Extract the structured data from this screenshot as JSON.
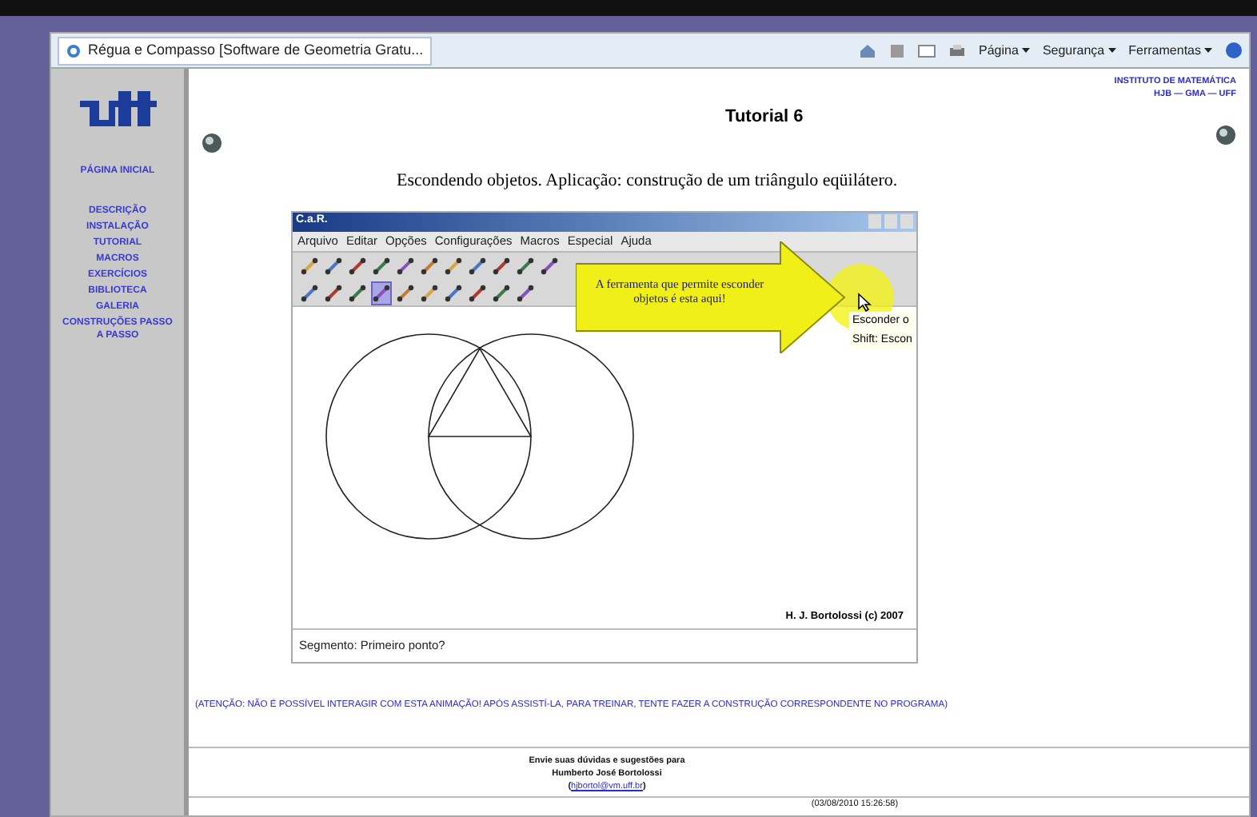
{
  "browser": {
    "tab_title": "Régua e Compasso [Software de Geometria Gratu...",
    "menus": [
      "Página",
      "Segurança",
      "Ferramentas"
    ]
  },
  "sidebar": {
    "home": "PÁGINA INICIAL",
    "items": [
      "DESCRIÇÃO",
      "INSTALAÇÃO",
      "TUTORIAL",
      "MACROS",
      "EXERCÍCIOS",
      "BIBLIOTECA",
      "GALERIA",
      "CONSTRUÇÕES PASSO A PASSO"
    ]
  },
  "header": {
    "institute": "INSTITUTO DE MATEMÁTICA",
    "groups": "HJB — GMA — UFF",
    "title": "Tutorial 6"
  },
  "subtitle": "Escondendo objetos. Aplicação: construção de um triângulo eqüilátero.",
  "applet": {
    "title": "C.a.R.",
    "menu": [
      "Arquivo",
      "Editar",
      "Opções",
      "Configurações",
      "Macros",
      "Especial",
      "Ajuda"
    ],
    "credit": "H. J. Bortolossi (c) 2007",
    "status": "Segmento: Primeiro ponto?",
    "callout": "A ferramenta que permite esconder objetos é esta aqui!",
    "tooltip": [
      "Esconder o",
      "Shift: Escon"
    ],
    "toolbar_rows": [
      [
        {
          "selected": false
        },
        {
          "selected": false
        },
        {
          "selected": false
        },
        {
          "selected": false
        },
        {
          "selected": false
        },
        {
          "selected": false
        },
        {
          "selected": false
        },
        {
          "selected": false
        },
        {
          "selected": false
        },
        {
          "selected": false
        },
        {
          "selected": false
        }
      ],
      [
        {
          "selected": false
        },
        {
          "selected": false
        },
        {
          "selected": false
        },
        {
          "selected": true
        },
        {
          "selected": false
        },
        {
          "selected": false
        },
        {
          "selected": false
        },
        {
          "selected": false
        },
        {
          "selected": false
        },
        {
          "selected": false
        }
      ]
    ]
  },
  "warning": "(ATENÇÃO: NÃO É POSSÍVEL INTERAGIR COM ESTA ANIMAÇÃO! APÓS ASSISTÍ-LA, PARA TREINAR, TENTE FAZER A CONSTRUÇÃO CORRESPONDENTE NO PROGRAMA)",
  "footer": {
    "line1": "Envie suas dúvidas e sugestões para",
    "line2": "Humberto José Bortolossi",
    "email_open": "(",
    "email": "hjbortol@vm.uff.br",
    "email_close": ")",
    "timestamp": "(03/08/2010 15:26:58)"
  }
}
